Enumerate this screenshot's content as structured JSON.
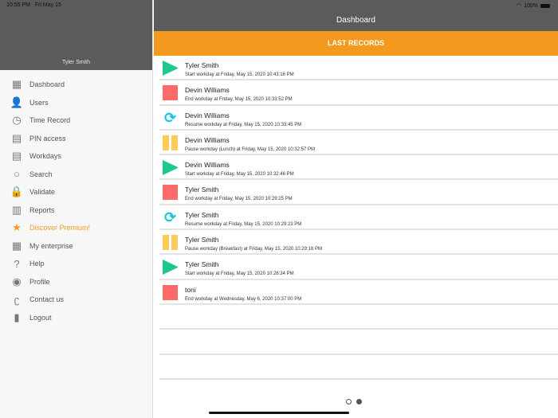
{
  "status": {
    "time": "10:55 PM",
    "date": "Fri May 15",
    "battery": "100%"
  },
  "sidebar": {
    "user": "Tyler Smith",
    "items": [
      {
        "label": "Dashboard",
        "icon": "grid-icon"
      },
      {
        "label": "Users",
        "icon": "user-icon"
      },
      {
        "label": "Time Record",
        "icon": "clock-icon"
      },
      {
        "label": "PIN access",
        "icon": "pin-icon"
      },
      {
        "label": "Workdays",
        "icon": "document-icon"
      },
      {
        "label": "Search",
        "icon": "search-icon"
      },
      {
        "label": "Validate",
        "icon": "lock-icon"
      },
      {
        "label": "Reports",
        "icon": "report-icon"
      },
      {
        "label": "Discover Premium!",
        "icon": "star-icon"
      },
      {
        "label": "My enterprise",
        "icon": "building-icon"
      },
      {
        "label": "Help",
        "icon": "help-icon"
      },
      {
        "label": "Profile",
        "icon": "profile-icon"
      },
      {
        "label": "Contact us",
        "icon": "ear-icon"
      },
      {
        "label": "Logout",
        "icon": "logout-icon"
      }
    ]
  },
  "header": {
    "title": "Dashboard",
    "section": "LAST RECORDS"
  },
  "records": [
    {
      "type": "start",
      "name": "Tyler Smith",
      "desc": "Start workday at Friday, May 15, 2020 10:43:16 PM"
    },
    {
      "type": "end",
      "name": "Devin Williams",
      "desc": "End workday at Friday, May 15, 2020 10:33:52 PM"
    },
    {
      "type": "resume",
      "name": "Devin Williams",
      "desc": "Resume workday at Friday, May 15, 2020 10:33:45 PM"
    },
    {
      "type": "pause",
      "name": "Devin Williams",
      "desc": "Pause workday (Lunch) at Friday, May 15, 2020 10:32:57 PM"
    },
    {
      "type": "start",
      "name": "Devin Williams",
      "desc": "Start workday at Friday, May 15, 2020 10:32:46 PM"
    },
    {
      "type": "end",
      "name": "Tyler Smith",
      "desc": "End workday at Friday, May 15, 2020 10:29:25 PM"
    },
    {
      "type": "resume",
      "name": "Tyler Smith",
      "desc": "Resume workday at Friday, May 15, 2020 10:29:23 PM"
    },
    {
      "type": "pause",
      "name": "Tyler Smith",
      "desc": "Pause workday (Breakfast) at Friday, May 15, 2020 10:29:16 PM"
    },
    {
      "type": "start",
      "name": "Tyler Smith",
      "desc": "Start workday at Friday, May 15, 2020 10:28:34 PM"
    },
    {
      "type": "end",
      "name": "toni",
      "desc": "End workday at Wednesday, May 6, 2020 10:37:00 PM"
    }
  ],
  "pager": {
    "pages": 2,
    "current": 2
  },
  "colors": {
    "accent": "#f39a1e",
    "header": "#5a5b5a",
    "start": "#1ec88b",
    "end": "#fc6a6a",
    "pause": "#fdcb5b",
    "resume": "#1fc4e0"
  }
}
